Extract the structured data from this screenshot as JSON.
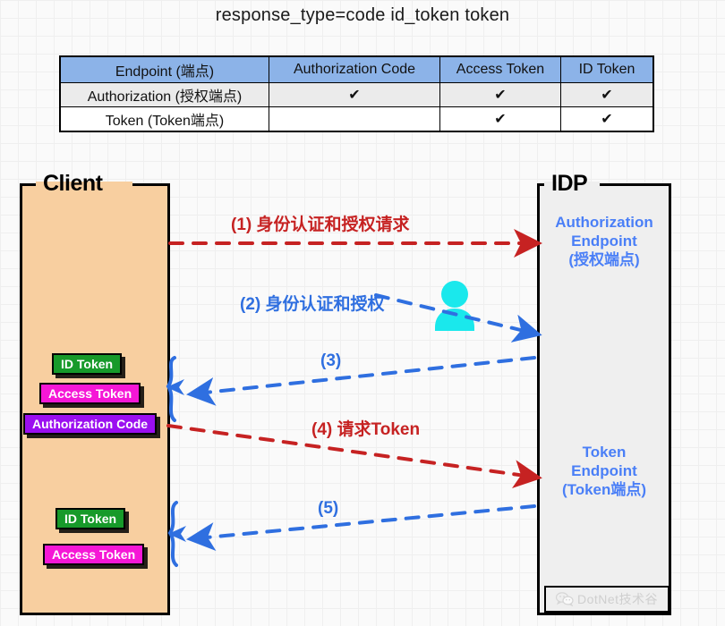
{
  "title": "response_type=code id_token token",
  "table": {
    "headers": [
      "Endpoint (端点)",
      "Authorization Code",
      "Access Token",
      "ID Token"
    ],
    "check_glyph": "✔",
    "rows": [
      {
        "endpoint": "Authorization (授权端点)",
        "authorization_code": "✔",
        "access_token": "✔",
        "id_token": "✔"
      },
      {
        "endpoint": "Token (Token端点)",
        "authorization_code": "",
        "access_token": "✔",
        "id_token": "✔"
      }
    ]
  },
  "client": {
    "label": "Client",
    "tokens_top": [
      {
        "name": "ID Token",
        "color": "#179a2a"
      },
      {
        "name": "Access Token",
        "color": "#f517d6"
      },
      {
        "name": "Authorization Code",
        "color": "#9b0ff0"
      }
    ],
    "tokens_bottom": [
      {
        "name": "ID Token",
        "color": "#179a2a"
      },
      {
        "name": "Access Token",
        "color": "#f517d6"
      }
    ]
  },
  "idp": {
    "label": "IDP",
    "authorization_endpoint": {
      "line1": "Authorization",
      "line2": "Endpoint",
      "line3": "(授权端点)"
    },
    "token_endpoint": {
      "line1": "Token",
      "line2": "Endpoint",
      "line3": "(Token端点)"
    },
    "text_color": "#4a7ff7"
  },
  "flows": [
    {
      "step": "(1)",
      "text": "身份认证和授权请求",
      "color": "#c62222",
      "style": "dashed",
      "direction": "client-to-idp"
    },
    {
      "step": "(2)",
      "text": "身份认证和授权",
      "color": "#2f6fe0",
      "style": "dashed",
      "direction": "client-to-idp"
    },
    {
      "step": "(3)",
      "text": "",
      "color": "#2f6fe0",
      "style": "dashed",
      "direction": "idp-to-client"
    },
    {
      "step": "(4)",
      "text": "请求Token",
      "color": "#c62222",
      "style": "dashed",
      "direction": "client-to-idp"
    },
    {
      "step": "(5)",
      "text": "",
      "color": "#2f6fe0",
      "style": "dashed",
      "direction": "idp-to-client"
    }
  ],
  "person_icon": {
    "name": "user-icon",
    "color": "#1ae8ec"
  },
  "watermark": {
    "text": "DotNet技术谷",
    "icon": "wechat-icon"
  }
}
